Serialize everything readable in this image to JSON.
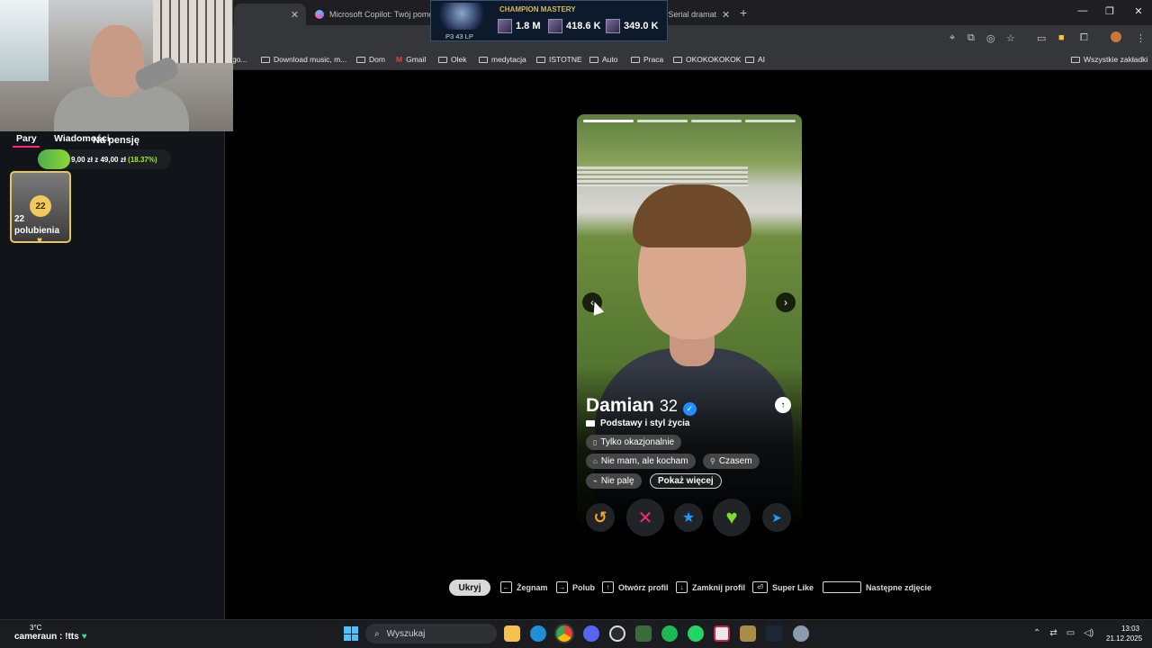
{
  "browser": {
    "tabs": [
      {
        "label": ""
      },
      {
        "label": "Microsoft Copilot: Twój pomoc"
      },
      {
        "label": "Odcinki Friends - Serial dramat"
      }
    ],
    "bookmarks": [
      {
        "label": "go...",
        "icon": "bookmark-icon"
      },
      {
        "label": "Download music, m...",
        "icon": "page-icon"
      },
      {
        "label": "Dom",
        "icon": "folder-icon"
      },
      {
        "label": "Gmail",
        "icon": "gmail-icon"
      },
      {
        "label": "Olek",
        "icon": "folder-icon"
      },
      {
        "label": "medytacja",
        "icon": "folder-icon"
      },
      {
        "label": "ISTOTNE",
        "icon": "folder-icon"
      },
      {
        "label": "Auto",
        "icon": "folder-icon"
      },
      {
        "label": "Praca",
        "icon": "folder-icon"
      },
      {
        "label": "OKOKOKOKOK",
        "icon": "folder-icon"
      },
      {
        "label": "AI",
        "icon": "folder-icon"
      }
    ],
    "all_bookmarks": "Wszystkie zakładki"
  },
  "mastery": {
    "title": "CHAMPION MASTERY",
    "rank": "P3 43 LP",
    "stats": [
      "1.8 M",
      "418.6 K",
      "349.0 K"
    ]
  },
  "sidebar": {
    "tabs": [
      "Pary",
      "Wiadomości"
    ],
    "pension_title": "Na pensję",
    "pension_amount": "9,00 zł z 49,00 zł",
    "pension_percent": "(18.37%)",
    "pension_progress": 0.1837,
    "likes_badge": "22",
    "likes_count": "22",
    "likes_label": "polubienia"
  },
  "profile": {
    "name": "Damian",
    "age": "32",
    "section": "Podstawy i styl życia",
    "chips": [
      {
        "label": "Tylko okazjonalnie",
        "icon": "drink-icon"
      },
      {
        "label": "Nie mam, ale kocham",
        "icon": "pet-icon"
      },
      {
        "label": "Czasem",
        "icon": "workout-icon"
      },
      {
        "label": "Nie palę",
        "icon": "smoke-icon"
      }
    ],
    "more": "Pokaż więcej",
    "photo_count": 4
  },
  "actions": [
    {
      "name": "rewind",
      "glyph": "↺",
      "color": "#f5a623"
    },
    {
      "name": "nope",
      "glyph": "✕",
      "color": "#fd267a"
    },
    {
      "name": "super-like",
      "glyph": "★",
      "color": "#1e9bff"
    },
    {
      "name": "like",
      "glyph": "♥",
      "color": "#7ddc2f"
    },
    {
      "name": "boost",
      "glyph": "➤",
      "color": "#1e9bff"
    }
  ],
  "shortcuts": {
    "hide": "Ukryj",
    "items": [
      {
        "key": "←",
        "label": "Żegnam"
      },
      {
        "key": "→",
        "label": "Polub"
      },
      {
        "key": "↑",
        "label": "Otwórz profil"
      },
      {
        "key": "↓",
        "label": "Zamknij profil"
      },
      {
        "key": "⏎",
        "label": "Super Like"
      },
      {
        "key": "",
        "label": "Następne zdjęcie"
      }
    ]
  },
  "taskbar": {
    "weather": "3°C",
    "chat": "cameraun : !tts",
    "search_placeholder": "Wyszukaj",
    "time": "13:03",
    "date": "21.12.2025"
  }
}
